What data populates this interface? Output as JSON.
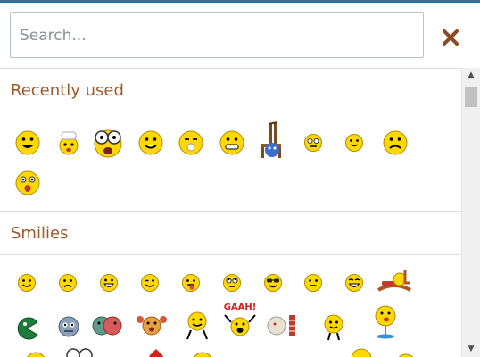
{
  "search": {
    "placeholder": "Search..."
  },
  "icons": {
    "close": "close-icon",
    "scroll_up": "scroll-up-arrow-icon",
    "scroll_down": "scroll-down-arrow-icon"
  },
  "colors": {
    "accent": "#2e6f9c",
    "section_title": "#9b5a2c",
    "close": "#8a4b26",
    "smiley": "#ffd800"
  },
  "sections": [
    {
      "title": "Recently used"
    },
    {
      "title": "Smilies"
    }
  ],
  "scrollbar": {
    "up_glyph": "▲",
    "down_glyph": "▼"
  },
  "stickers": {
    "gaah": "GAAH!"
  }
}
